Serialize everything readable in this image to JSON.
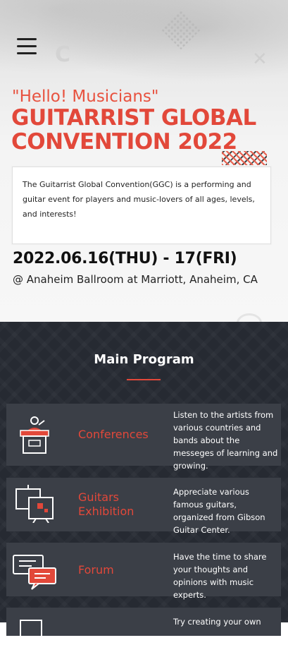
{
  "hero": {
    "tagline": "\"Hello! Musicians\"",
    "title": "GUITARRIST GLOBAL CONVENTION 2022",
    "description": "The Guitarrist Global Convention(GGC) is a performing and guitar event for players and music-lovers of all ages, levels, and interests!",
    "dates": "2022.06.16(THU) - 17(FRI)",
    "venue": "@ Anaheim Ballroom at Marriott, Anaheim, CA"
  },
  "nav": {
    "menu_icon": "hamburger-menu-icon",
    "close_icon": "close-icon"
  },
  "main_program": {
    "title": "Main Program",
    "items": [
      {
        "label": "Conferences",
        "icon": "podium-icon",
        "text": "Listen to the artists from various countries and bands about the messeges of learning and growing."
      },
      {
        "label": "Guitars Exhibition",
        "icon": "easel-icon",
        "text": "Appreciate various famous guitars, organized from Gibson Guitar Center."
      },
      {
        "label": "Forum",
        "icon": "chat-bubbles-icon",
        "text": "Have the time to share your thoughts and opinions with music experts."
      },
      {
        "label": "",
        "icon": "",
        "text": "Try creating your own"
      }
    ]
  },
  "colors": {
    "accent": "#e2483a",
    "dark_bg": "#262a32",
    "card_bg": "#3b3f47"
  }
}
